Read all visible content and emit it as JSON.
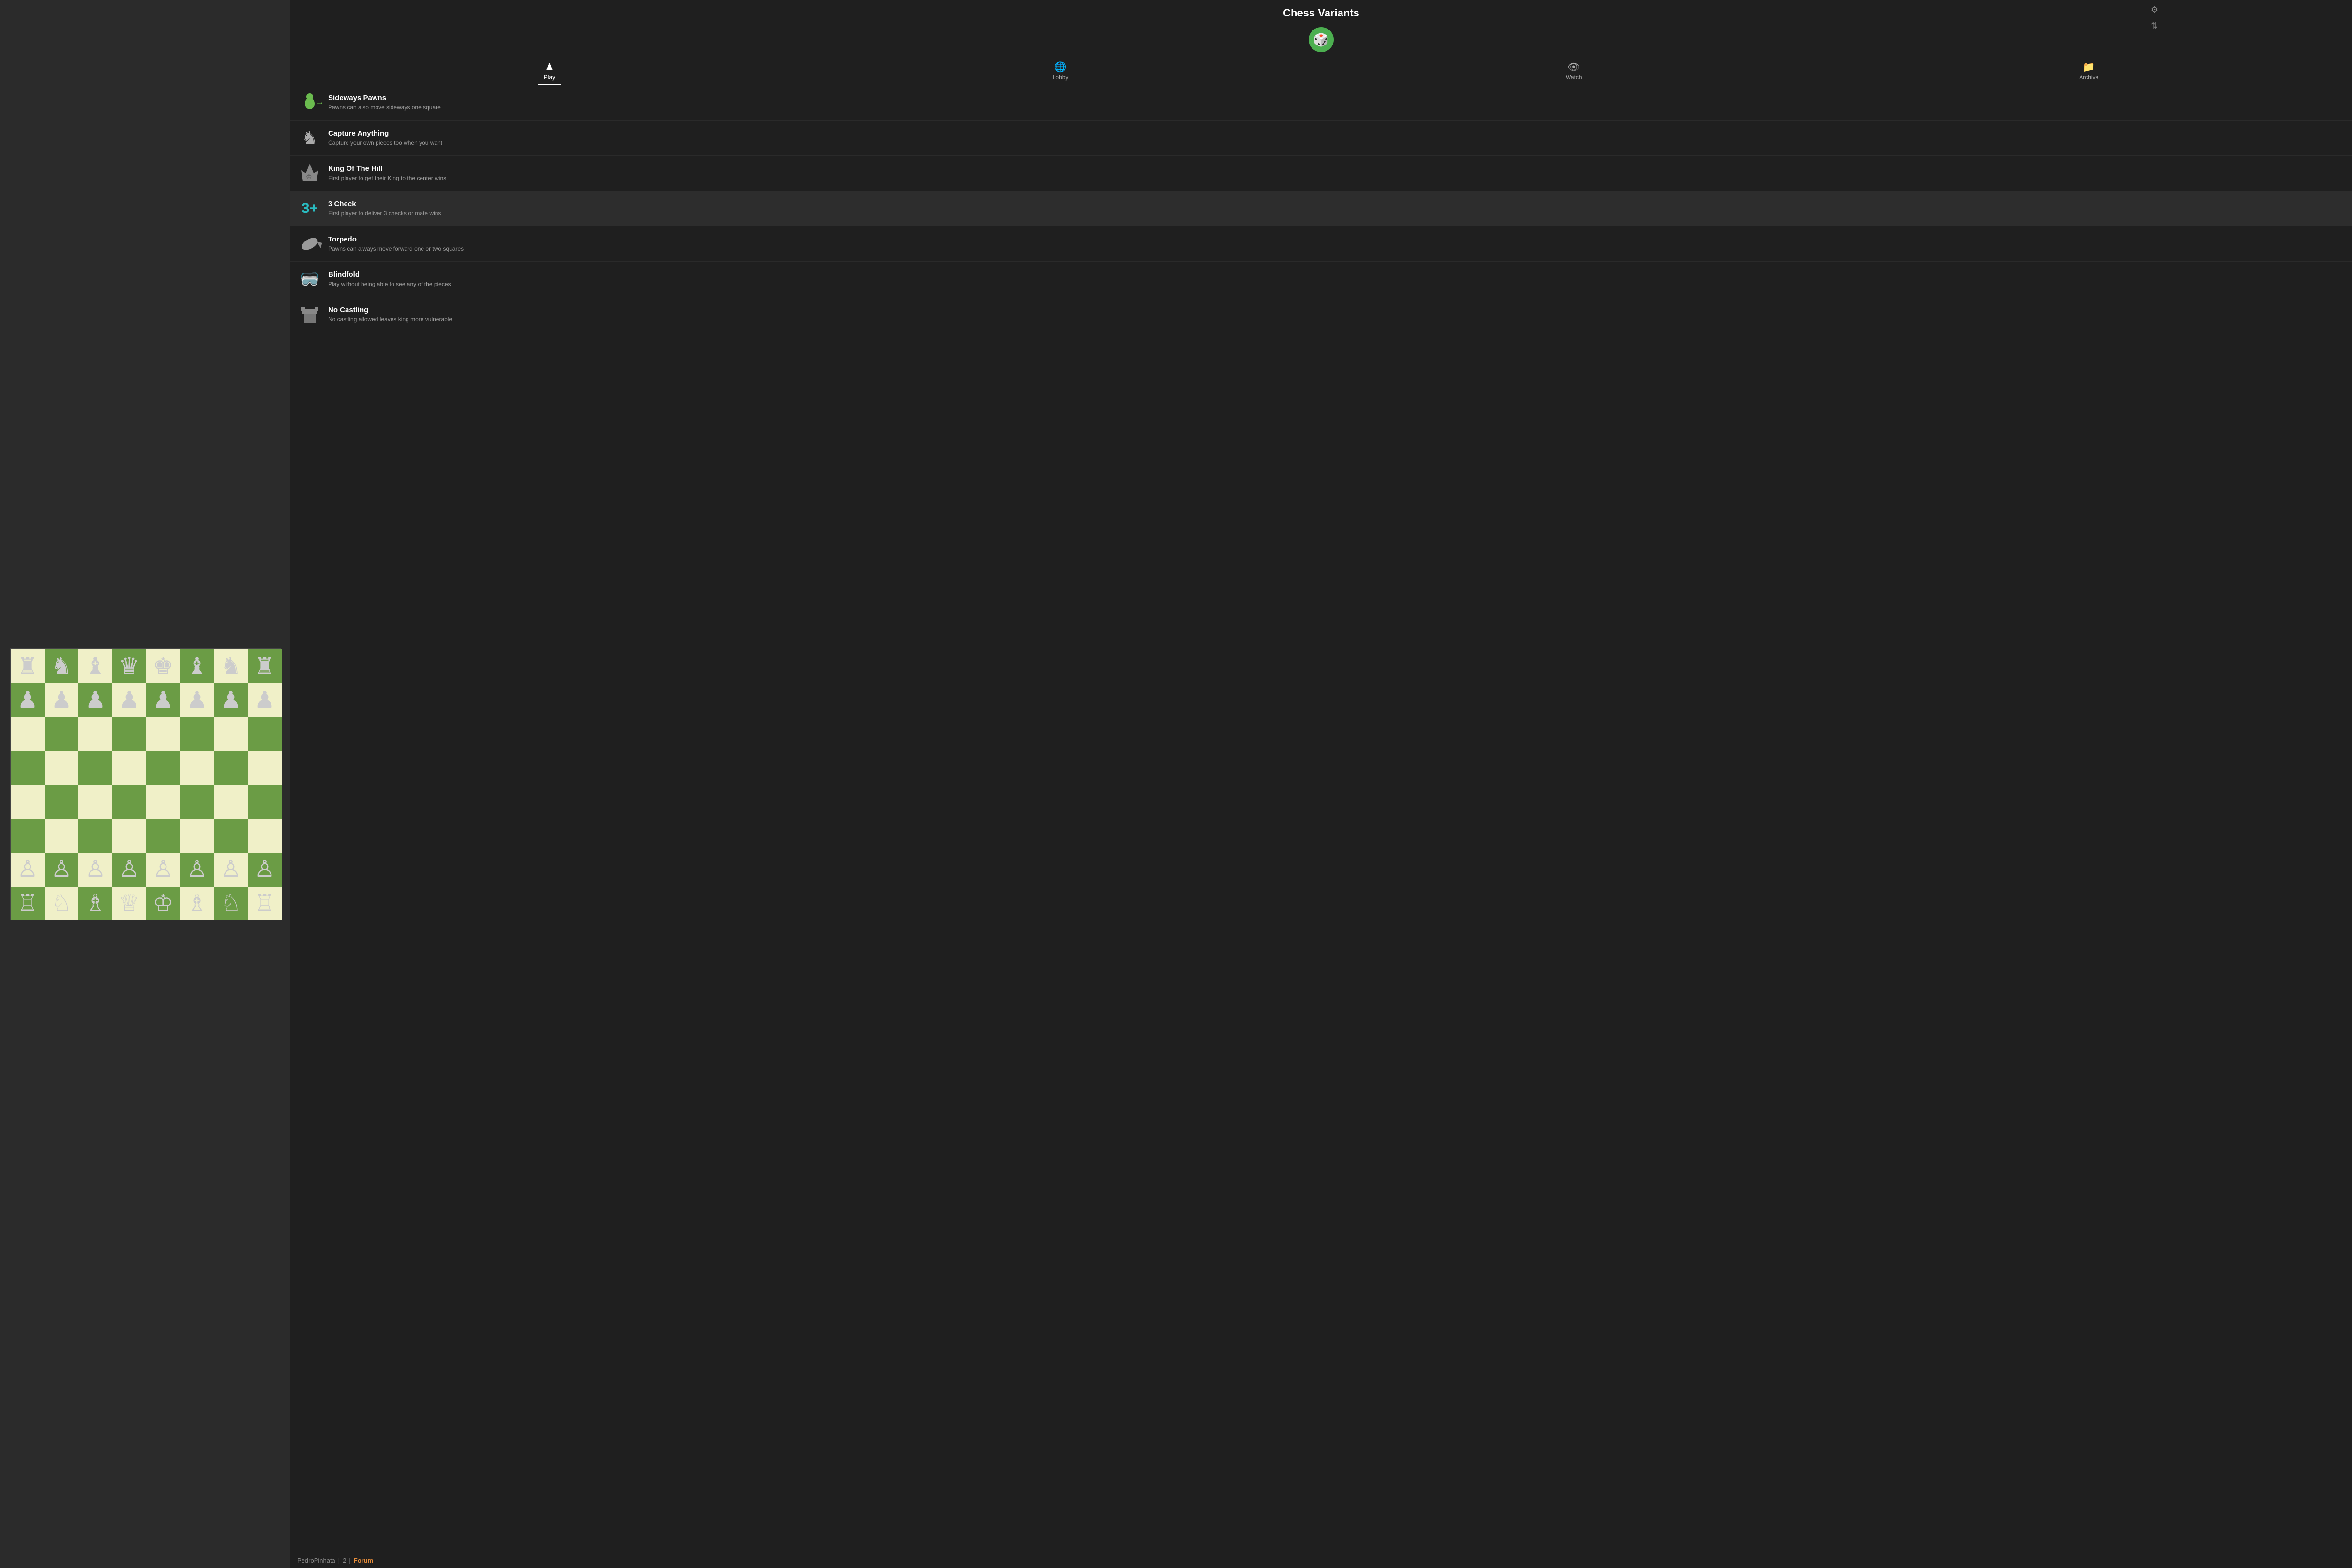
{
  "page": {
    "title": "Chess Variants"
  },
  "top_icons": {
    "gear": "⚙",
    "swap": "⇅"
  },
  "logo": {
    "icon": "🎲"
  },
  "nav": {
    "tabs": [
      {
        "id": "play",
        "label": "Play",
        "icon": "♟",
        "active": true
      },
      {
        "id": "lobby",
        "label": "Lobby",
        "icon": "🌐",
        "active": false
      },
      {
        "id": "watch",
        "label": "Watch",
        "icon": "👁",
        "active": false
      },
      {
        "id": "archive",
        "label": "Archive",
        "icon": "📁",
        "active": false
      }
    ]
  },
  "variants": [
    {
      "id": "sideways-pawns",
      "name": "Sideways Pawns",
      "description": "Pawns can also move sideways one square",
      "icon": "♟→",
      "iconType": "sideways"
    },
    {
      "id": "capture-anything",
      "name": "Capture Anything",
      "description": "Capture your own pieces too when you want",
      "icon": "♞",
      "iconType": "capture"
    },
    {
      "id": "king-of-the-hill",
      "name": "King Of The Hill",
      "description": "First player to get their King to the center wins",
      "icon": "♔",
      "iconType": "koth"
    },
    {
      "id": "3-check",
      "name": "3 Check",
      "description": "First player to deliver 3 checks or mate wins",
      "icon": "3+",
      "iconType": "3check"
    },
    {
      "id": "torpedo",
      "name": "Torpedo",
      "description": "Pawns can always move forward one or two squares",
      "icon": "🚀",
      "iconType": "torpedo"
    },
    {
      "id": "blindfold",
      "name": "Blindfold",
      "description": "Play without being able to see any of the pieces",
      "icon": "🥽",
      "iconType": "blindfold"
    },
    {
      "id": "no-castling",
      "name": "No Castling",
      "description": "No castling allowed leaves king more vulnerable",
      "icon": "♜",
      "iconType": "nocastling"
    }
  ],
  "footer": {
    "username": "PedroPinhata",
    "separator": "|",
    "count": "2",
    "forum_label": "Forum"
  },
  "board": {
    "pieces": [
      [
        "♜",
        "♞",
        "♝",
        "♛",
        "♚",
        "♝",
        "♞",
        "♜"
      ],
      [
        "♟",
        "♟",
        "♟",
        "♟",
        "♟",
        "♟",
        "♟",
        "♟"
      ],
      [
        "",
        "",
        "",
        "",
        "",
        "",
        "",
        ""
      ],
      [
        "",
        "",
        "",
        "",
        "",
        "",
        "",
        ""
      ],
      [
        "",
        "",
        "",
        "",
        "",
        "",
        "",
        ""
      ],
      [
        "",
        "",
        "",
        "",
        "",
        "",
        "",
        ""
      ],
      [
        "♙",
        "♙",
        "♙",
        "♙",
        "♙",
        "♙",
        "♙",
        "♙"
      ],
      [
        "♖",
        "♘",
        "♗",
        "♕",
        "♔",
        "♗",
        "♘",
        "♖"
      ]
    ]
  }
}
